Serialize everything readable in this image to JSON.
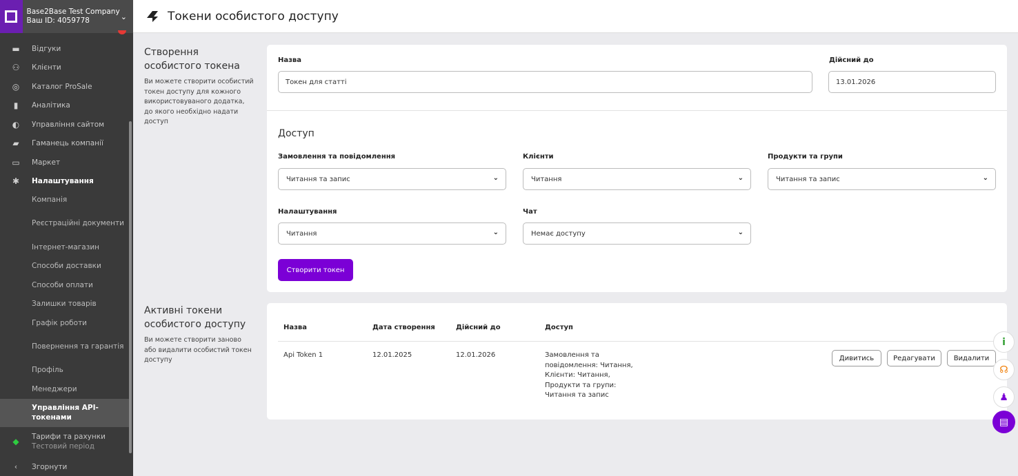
{
  "company": {
    "name": "Base2Base Test Company",
    "id_label": "Ваш ID: 4059778"
  },
  "header": {
    "title": "Токени особистого доступу"
  },
  "sidebar": {
    "items": [
      {
        "label": "Відгуки",
        "icon": "message-icon"
      },
      {
        "label": "Клієнти",
        "icon": "users-icon"
      },
      {
        "label": "Каталог ProSale",
        "icon": "target-icon"
      },
      {
        "label": "Аналітика",
        "icon": "bar-chart-icon"
      },
      {
        "label": "Управління сайтом",
        "icon": "globe-icon"
      },
      {
        "label": "Гаманець компанії",
        "icon": "wallet-icon"
      },
      {
        "label": "Маркет",
        "icon": "store-icon"
      },
      {
        "label": "Налаштування",
        "icon": "gear-icon"
      }
    ],
    "sub_items": [
      "Компанія",
      "Реєстраційні документи",
      "Інтернет-магазин",
      "Способи доставки",
      "Способи оплати",
      "Залишки товарів",
      "Графік роботи",
      "Повернення та гарантія",
      "Профіль",
      "Менеджери",
      "Управління API-токенами"
    ],
    "tariff": {
      "label": "Тарифи та рахунки",
      "sub": "Тестовий період"
    },
    "collapse_label": "Згорнути"
  },
  "create": {
    "title": "Створення особистого токена",
    "description": "Ви можете створити особистий токен доступу для кожного використовуваного додатка, до якого необхідно надати доступ",
    "name_label": "Назва",
    "name_value": "Токен для статті",
    "valid_label": "Дійсний до",
    "valid_value": "13.01.2026",
    "access_title": "Доступ",
    "fields": [
      {
        "label": "Замовлення та повідомлення",
        "value": "Читання та запис"
      },
      {
        "label": "Клієнти",
        "value": "Читання"
      },
      {
        "label": "Продукти та групи",
        "value": "Читання та запис"
      },
      {
        "label": "Налаштування",
        "value": "Читання"
      },
      {
        "label": "Чат",
        "value": "Немає доступу"
      }
    ],
    "submit_label": "Створити токен"
  },
  "active": {
    "title": "Активні токени особистого доступу",
    "description": "Ви можете створити заново або видалити особистий токен доступу",
    "columns": [
      "Назва",
      "Дата створення",
      "Дійсний до",
      "Доступ"
    ],
    "rows": [
      {
        "name": "Api Token 1",
        "created": "12.01.2025",
        "valid": "12.01.2026",
        "access_lines": [
          "Замовлення та",
          "повідомлення: Читання,",
          "Клієнти: Читання,",
          "Продукти та групи:",
          "Читання та запис"
        ],
        "actions": [
          "Дивитись",
          "Редагувати",
          "Видалити"
        ]
      }
    ]
  },
  "floating": [
    {
      "icon": "info-icon",
      "glyph": "i"
    },
    {
      "icon": "support-icon",
      "glyph": "☊"
    },
    {
      "icon": "user-icon",
      "glyph": "♟"
    },
    {
      "icon": "chat-icon",
      "glyph": "▤"
    }
  ],
  "colors": {
    "accent": "#7b00d6",
    "sidebar": "#3a3a3a",
    "brand_logo": "#6b1fb1"
  }
}
